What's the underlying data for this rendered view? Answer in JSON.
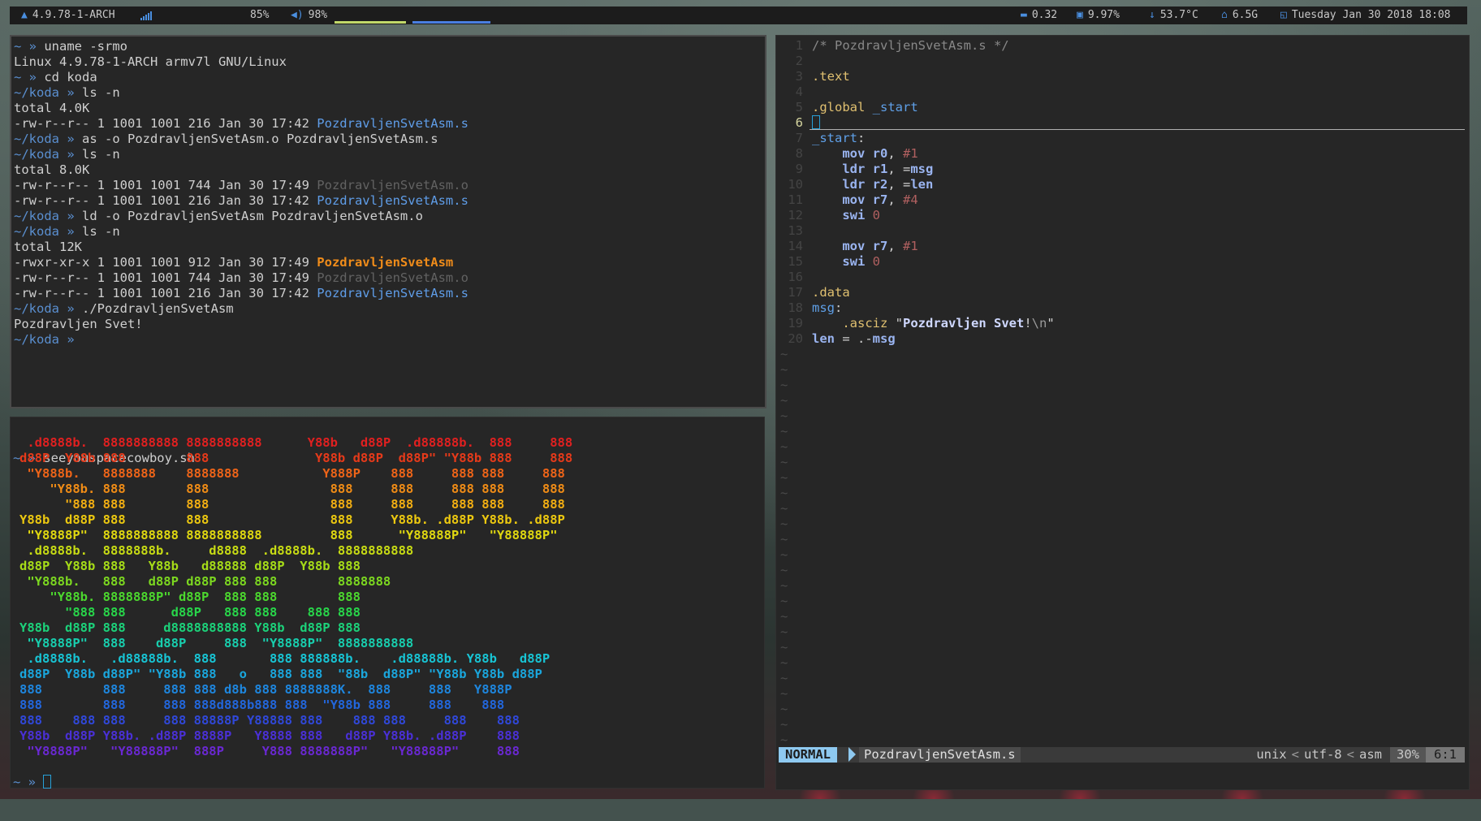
{
  "statusbar": {
    "os_label": "4.9.78-1-ARCH",
    "brightness": "85%",
    "volume": "98%",
    "load": "0.32",
    "cpu": "9.97%",
    "temp": "53.7°C",
    "disk": "6.5G",
    "datetime": "Tuesday Jan 30 2018 18:08",
    "icons": [
      "arch-icon",
      "wifi-icon",
      "volume-icon",
      "load-icon",
      "cpu-icon",
      "temp-icon",
      "home-icon",
      "clock-icon"
    ],
    "accent_color": "#4a8fe0"
  },
  "term1": {
    "lines": [
      {
        "prompt": "~ » ",
        "text": "uname -srmo",
        "style": ""
      },
      {
        "prompt": "",
        "text": "Linux 4.9.78-1-ARCH armv7l GNU/Linux",
        "style": ""
      },
      {
        "prompt": "~ » ",
        "text": "cd koda",
        "style": ""
      },
      {
        "prompt": "~/koda » ",
        "text": "ls -n",
        "style": ""
      },
      {
        "prompt": "",
        "text": "total 4.0K",
        "style": ""
      },
      {
        "prompt": "",
        "text": "-rw-r--r-- 1 1001 1001 216 Jan 30 17:42 ",
        "file": "PozdravljenSvetAsm.s",
        "fstyle": "src"
      },
      {
        "prompt": "~/koda » ",
        "text": "as -o PozdravljenSvetAsm.o PozdravljenSvetAsm.s",
        "style": ""
      },
      {
        "prompt": "~/koda » ",
        "text": "ls -n",
        "style": ""
      },
      {
        "prompt": "",
        "text": "total 8.0K",
        "style": ""
      },
      {
        "prompt": "",
        "text": "-rw-r--r-- 1 1001 1001 744 Jan 30 17:49 ",
        "file": "PozdravljenSvetAsm.o",
        "fstyle": "obj"
      },
      {
        "prompt": "",
        "text": "-rw-r--r-- 1 1001 1001 216 Jan 30 17:42 ",
        "file": "PozdravljenSvetAsm.s",
        "fstyle": "src"
      },
      {
        "prompt": "~/koda » ",
        "text": "ld -o PozdravljenSvetAsm PozdravljenSvetAsm.o",
        "style": ""
      },
      {
        "prompt": "~/koda » ",
        "text": "ls -n",
        "style": ""
      },
      {
        "prompt": "",
        "text": "total 12K",
        "style": ""
      },
      {
        "prompt": "",
        "text": "-rwxr-xr-x 1 1001 1001 912 Jan 30 17:49 ",
        "file": "PozdravljenSvetAsm",
        "fstyle": "exe"
      },
      {
        "prompt": "",
        "text": "-rw-r--r-- 1 1001 1001 744 Jan 30 17:49 ",
        "file": "PozdravljenSvetAsm.o",
        "fstyle": "obj"
      },
      {
        "prompt": "",
        "text": "-rw-r--r-- 1 1001 1001 216 Jan 30 17:42 ",
        "file": "PozdravljenSvetAsm.s",
        "fstyle": "src"
      },
      {
        "prompt": "~/koda » ",
        "text": "./PozdravljenSvetAsm",
        "style": ""
      },
      {
        "prompt": "",
        "text": "Pozdravljen Svet!",
        "style": ""
      },
      {
        "prompt": "~/koda » ",
        "text": "",
        "style": ""
      }
    ]
  },
  "term2": {
    "command_prompt": "~ » ",
    "command": "seeyouspacecowboy.sh",
    "final_prompt": "~ » ",
    "ascii_art": [
      {
        "text": " .d8888b.  8888888888 8888888888      Y88b   d88P  .d88888b.  888     888",
        "color": "#e02020"
      },
      {
        "text": "d88P  Y88b 888        888              Y88b d88P  d88P\" \"Y88b 888     888",
        "color": "#e63a1a"
      },
      {
        "text": " \"Y888b.   8888888    8888888           Y888P    888     888 888     888",
        "color": "#ee6418"
      },
      {
        "text": "    \"Y88b. 888        888                888     888     888 888     888",
        "color": "#f08c16"
      },
      {
        "text": "      \"888 888        888                888     888     888 888     888",
        "color": "#f2ae12"
      },
      {
        "text": "Y88b  d88P 888        888                888     Y88b. .d88P Y88b. .d88P",
        "color": "#ecc810"
      },
      {
        "text": " \"Y8888P\"  8888888888 8888888888         888      \"Y88888P\"   \"Y88888P\"",
        "color": "#e0d810"
      },
      {
        "text": " .d8888b.  8888888b.     d8888  .d8888b.  8888888888",
        "color": "#c8dc14"
      },
      {
        "text": "d88P  Y88b 888   Y88b   d88888 d88P  Y88b 888",
        "color": "#a6dc18"
      },
      {
        "text": " \"Y888b.   888   d88P d88P 888 888        8888888",
        "color": "#7cd820"
      },
      {
        "text": "    \"Y88b. 8888888P\" d88P  888 888        888",
        "color": "#4cd82e"
      },
      {
        "text": "      \"888 888      d88P   888 888    888 888",
        "color": "#28d64a"
      },
      {
        "text": "Y88b  d88P 888     d8888888888 Y88b  d88P 888",
        "color": "#1cd27a"
      },
      {
        "text": " \"Y8888P\"  888    d88P     888  \"Y8888P\"  8888888888",
        "color": "#18ceae"
      },
      {
        "text": " .d8888b.   .d88888b.  888       888 888888b.    .d88888b. Y88b   d88P",
        "color": "#18c4d4"
      },
      {
        "text": "d88P  Y88b d88P\" \"Y88b 888   o   888 888  \"88b  d88P\" \"Y88b Y88b d88P",
        "color": "#1aa6dc"
      },
      {
        "text": "888        888     888 888 d8b 888 8888888K.  888     888   Y888P",
        "color": "#1e86de"
      },
      {
        "text": "888        888     888 888d888b888 888  \"Y88b 888     888    888",
        "color": "#2266dc"
      },
      {
        "text": "888    888 888     888 88888P Y88888 888    888 888     888    888",
        "color": "#3048da"
      },
      {
        "text": "Y88b  d88P Y88b. .d88P 8888P   Y8888 888   d88P Y88b. .d88P    888",
        "color": "#4a30d6"
      },
      {
        "text": " \"Y8888P\"   \"Y88888P\"  888P     Y888 8888888P\"   \"Y88888P\"     888",
        "color": "#6a28d2"
      }
    ]
  },
  "vim": {
    "lines": [
      {
        "n": "1",
        "tokens": [
          [
            "comment",
            "/* PozdravljenSvetAsm.s */"
          ]
        ]
      },
      {
        "n": "2",
        "tokens": []
      },
      {
        "n": "3",
        "tokens": [
          [
            "dir",
            ".text"
          ]
        ]
      },
      {
        "n": "4",
        "tokens": []
      },
      {
        "n": "5",
        "tokens": [
          [
            "dir",
            ".global"
          ],
          [
            "plain",
            " "
          ],
          [
            "label",
            "_start"
          ]
        ]
      },
      {
        "n": "6",
        "tokens": [],
        "current": true
      },
      {
        "n": "7",
        "tokens": [
          [
            "label",
            "_start"
          ],
          [
            "plain",
            ":"
          ]
        ]
      },
      {
        "n": "8",
        "tokens": [
          [
            "plain",
            "    "
          ],
          [
            "kw",
            "mov"
          ],
          [
            "plain",
            " "
          ],
          [
            "kw",
            "r0"
          ],
          [
            "plain",
            ", "
          ],
          [
            "num",
            "#1"
          ]
        ]
      },
      {
        "n": "9",
        "tokens": [
          [
            "plain",
            "    "
          ],
          [
            "kw",
            "ldr"
          ],
          [
            "plain",
            " "
          ],
          [
            "kw",
            "r1"
          ],
          [
            "plain",
            ", ="
          ],
          [
            "kw",
            "msg"
          ]
        ]
      },
      {
        "n": "10",
        "tokens": [
          [
            "plain",
            "    "
          ],
          [
            "kw",
            "ldr"
          ],
          [
            "plain",
            " "
          ],
          [
            "kw",
            "r2"
          ],
          [
            "plain",
            ", ="
          ],
          [
            "kw",
            "len"
          ]
        ]
      },
      {
        "n": "11",
        "tokens": [
          [
            "plain",
            "    "
          ],
          [
            "kw",
            "mov"
          ],
          [
            "plain",
            " "
          ],
          [
            "kw",
            "r7"
          ],
          [
            "plain",
            ", "
          ],
          [
            "num",
            "#4"
          ]
        ]
      },
      {
        "n": "12",
        "tokens": [
          [
            "plain",
            "    "
          ],
          [
            "kw",
            "swi"
          ],
          [
            "plain",
            " "
          ],
          [
            "num",
            "0"
          ]
        ]
      },
      {
        "n": "13",
        "tokens": []
      },
      {
        "n": "14",
        "tokens": [
          [
            "plain",
            "    "
          ],
          [
            "kw",
            "mov"
          ],
          [
            "plain",
            " "
          ],
          [
            "kw",
            "r7"
          ],
          [
            "plain",
            ", "
          ],
          [
            "num",
            "#1"
          ]
        ]
      },
      {
        "n": "15",
        "tokens": [
          [
            "plain",
            "    "
          ],
          [
            "kw",
            "swi"
          ],
          [
            "plain",
            " "
          ],
          [
            "num",
            "0"
          ]
        ]
      },
      {
        "n": "16",
        "tokens": []
      },
      {
        "n": "17",
        "tokens": [
          [
            "dir",
            ".data"
          ]
        ]
      },
      {
        "n": "18",
        "tokens": [
          [
            "label",
            "msg"
          ],
          [
            "plain",
            ":"
          ]
        ]
      },
      {
        "n": "19",
        "tokens": [
          [
            "plain",
            "    "
          ],
          [
            "dir",
            ".asciz"
          ],
          [
            "plain",
            " \""
          ],
          [
            "strb",
            "Pozdravljen Svet"
          ],
          [
            "plain",
            "!"
          ],
          [
            "esc",
            "\\n"
          ],
          [
            "plain",
            "\""
          ]
        ]
      },
      {
        "n": "20",
        "tokens": [
          [
            "kw",
            "len"
          ],
          [
            "plain",
            " = .-"
          ],
          [
            "kw",
            "msg"
          ]
        ]
      }
    ],
    "tilde_count": 26,
    "status": {
      "mode": "NORMAL",
      "filename": "PozdravljenSvetAsm.s",
      "fileformat": "unix",
      "encoding": "utf-8",
      "filetype": "asm",
      "percent": "30%",
      "position": "6:1"
    }
  }
}
